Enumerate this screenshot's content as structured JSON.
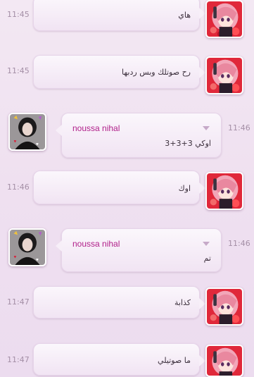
{
  "messages": [
    {
      "direction": "outgoing",
      "time": "11:45",
      "text": "هاي"
    },
    {
      "direction": "outgoing",
      "time": "11:45",
      "text": "رح صوتلك وبس ردبها"
    },
    {
      "direction": "incoming",
      "time": "11:46",
      "sender": "noussa nihal",
      "text": "اوكي 3+3+3"
    },
    {
      "direction": "outgoing",
      "time": "11:46",
      "text": "اوك"
    },
    {
      "direction": "incoming",
      "time": "11:46",
      "sender": "noussa nihal",
      "text": "تم"
    },
    {
      "direction": "outgoing",
      "time": "11:47",
      "text": "كذابة"
    },
    {
      "direction": "outgoing",
      "time": "11:47",
      "text": "ما صوتيلي"
    }
  ],
  "icons": {
    "self_avatar": "anime-girl-avatar",
    "contact_avatar": "contact-photo-avatar",
    "options": "chevron-down-icon"
  },
  "colors": {
    "sender_name": "#b0208a",
    "time": "#a48fa6",
    "background": "#efe0f0"
  }
}
